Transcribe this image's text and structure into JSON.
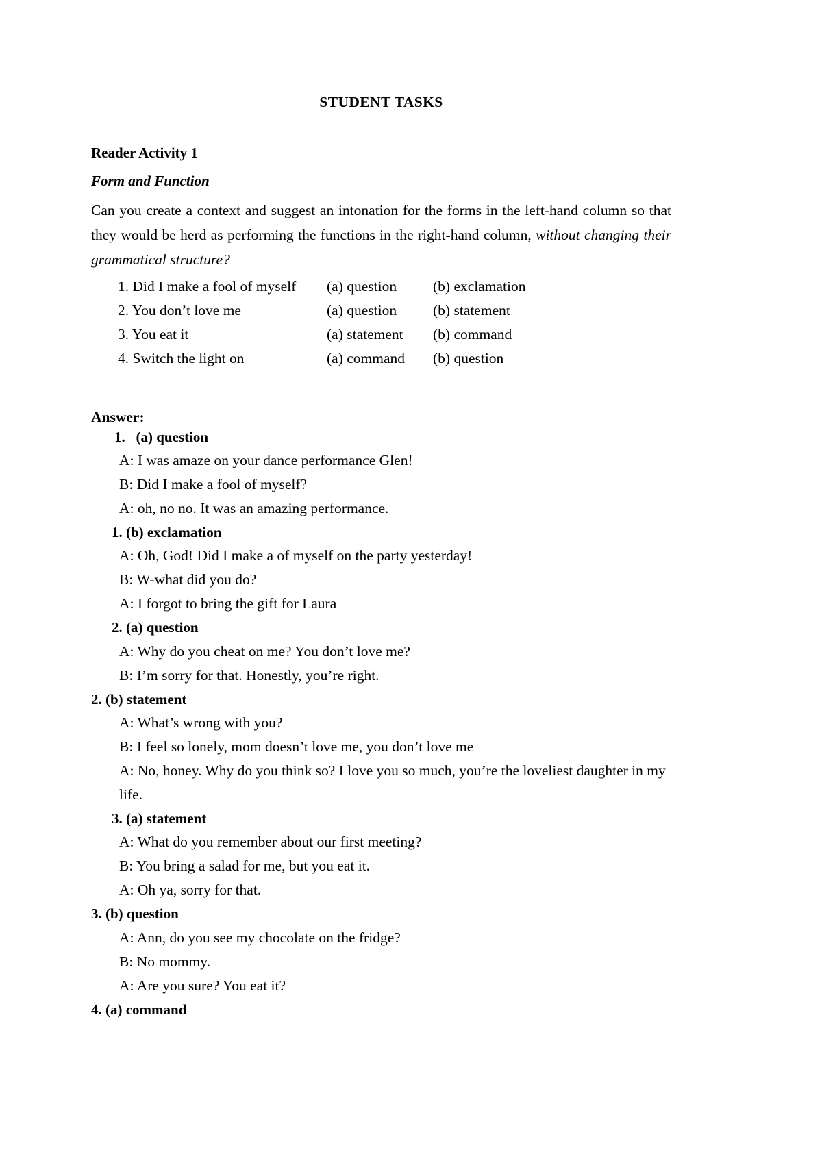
{
  "document": {
    "title": "STUDENT TASKS",
    "activity_heading": "Reader Activity 1",
    "activity_subheading": "Form and Function",
    "instructions": {
      "part1": "Can you create a context and suggest an intonation for the forms in the left-hand column so that they would be herd as performing the functions in the right-hand column, ",
      "part2_italic": "without changing their grammatical structure?"
    },
    "prompts": [
      {
        "number": "1.",
        "form": "Did I make a fool of myself",
        "option_a": "(a) question",
        "option_b": "(b) exclamation"
      },
      {
        "number": "2.",
        "form": "You don’t love me",
        "option_a": "(a) question",
        "option_b": "(b) statement"
      },
      {
        "number": "3.",
        "form": "You eat it",
        "option_a": "(a) statement",
        "option_b": "(b) command"
      },
      {
        "number": "4.",
        "form": "Switch the light on",
        "option_a": "(a) command",
        "option_b": "(b) question"
      }
    ],
    "answer_label": "Answer:",
    "answers": [
      {
        "heading": "1.   (a) question",
        "indent": "first",
        "lines": [
          "A: I was amaze on your dance performance Glen!",
          "B: Did I make a fool of myself?",
          "A: oh, no no. It was an amazing performance."
        ]
      },
      {
        "heading": "1. (b) exclamation",
        "indent": "mid",
        "lines": [
          "A: Oh, God! Did I make a of myself on the party yesterday!",
          "B: W-what did you do?",
          "A: I forgot to bring the gift for Laura"
        ]
      },
      {
        "heading": "2. (a) question",
        "indent": "mid",
        "lines": [
          "A: Why do you cheat on me? You don’t love me?",
          "B: I’m sorry for that. Honestly, you’re right."
        ]
      },
      {
        "heading": "2. (b) statement",
        "indent": "none",
        "lines": [
          "A: What’s wrong with you?",
          "B: I feel so lonely, mom doesn’t love me, you don’t love me",
          "A: No, honey. Why do you think so? I love you so much, you’re the loveliest daughter in my life."
        ]
      },
      {
        "heading": "3. (a) statement",
        "indent": "mid",
        "lines": [
          "A: What do you remember about our first meeting?",
          "B: You bring a salad for me, but you eat it.",
          "A: Oh ya, sorry for that."
        ]
      },
      {
        "heading": "3. (b) question",
        "indent": "none",
        "lines": [
          "A: Ann, do you see my chocolate on the fridge?",
          "B: No mommy.",
          "A: Are you sure? You eat it?"
        ]
      },
      {
        "heading": "4. (a) command",
        "indent": "none",
        "lines": []
      }
    ]
  }
}
